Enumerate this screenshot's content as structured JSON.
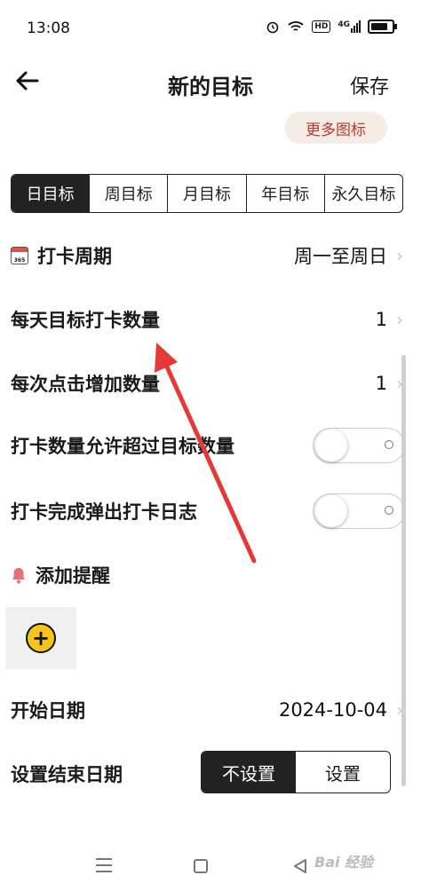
{
  "status_bar": {
    "time": "13:08",
    "network": "4G"
  },
  "header": {
    "title": "新的目标",
    "save_label": "保存"
  },
  "more_icons_label": "更多图标",
  "tabs": [
    {
      "label": "日目标",
      "active": true
    },
    {
      "label": "周目标",
      "active": false
    },
    {
      "label": "月目标",
      "active": false
    },
    {
      "label": "年目标",
      "active": false
    },
    {
      "label": "永久目标",
      "active": false
    }
  ],
  "settings": {
    "cycle": {
      "label": "打卡周期",
      "value": "周一至周日",
      "icon": "calendar-icon",
      "icon_text": "365"
    },
    "daily_target": {
      "label": "每天目标打卡数量",
      "value": "1"
    },
    "increment": {
      "label": "每次点击增加数量",
      "value": "1"
    },
    "allow_exceed": {
      "label": "打卡数量允许超过目标数量",
      "on": false
    },
    "popup_log": {
      "label": "打卡完成弹出打卡日志",
      "on": false
    },
    "reminder": {
      "label": "添加提醒",
      "icon": "bell-icon"
    },
    "start_date": {
      "label": "开始日期",
      "value": "2024-10-04"
    },
    "end_date": {
      "label": "设置结束日期",
      "options": [
        "不设置",
        "设置"
      ],
      "selected": "不设置"
    }
  },
  "watermark": "Bai 经验",
  "colors": {
    "accent_dark": "#222222",
    "add_yellow": "#f5c518",
    "more_icons_text": "#c0392b",
    "annotation_arrow": "#e53935"
  }
}
